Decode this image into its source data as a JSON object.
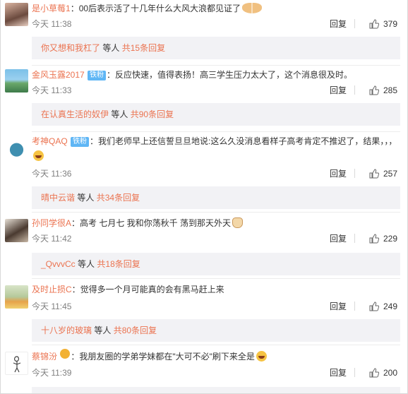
{
  "comments": [
    {
      "user": "是小草莓1",
      "badge": "",
      "text": "：00后表示活了十几年什么大风大浪都见证了",
      "emoji": "paws",
      "time": "今天 11:38",
      "reply_label": "回复",
      "likes": "379",
      "sub": {
        "who": "你又想和我杠了",
        "mid": "等人",
        "cnt": "共15条回复"
      }
    },
    {
      "user": "金风玉露2017",
      "badge": "铁粉",
      "text": "：反应快速，值得表扬！高三学生压力太大了，这个消息很及时。",
      "emoji": "",
      "time": "今天 11:33",
      "reply_label": "回复",
      "likes": "285",
      "sub": {
        "who": "在认真生活的奴伊",
        "mid": "等人",
        "cnt": "共90条回复"
      }
    },
    {
      "user": "考神QAQ",
      "badge": "铁粉",
      "text": "：我们老师早上还信誓旦旦地说:这么久没消息看样子高考肯定不推迟了，结果，，，",
      "emoji": "laugh",
      "time": "今天 11:36",
      "reply_label": "回复",
      "likes": "257",
      "sub": {
        "who": "晴中云谐",
        "mid": "等人",
        "cnt": "共34条回复"
      }
    },
    {
      "user": "孙同学很A",
      "badge": "",
      "text": "：高考 七月七 我和你荡秋千 荡到那天外天",
      "emoji": "cat",
      "time": "今天 11:42",
      "reply_label": "回复",
      "likes": "229",
      "sub": {
        "who": "_QvvvCc",
        "mid": "等人",
        "cnt": "共18条回复"
      }
    },
    {
      "user": "及时止损C",
      "badge": "",
      "text": "：觉得多一个月可能真的会有黑马赶上来",
      "emoji": "",
      "time": "今天 11:45",
      "reply_label": "回复",
      "likes": "249",
      "sub": {
        "who": "十八岁的玻璃",
        "mid": "等人",
        "cnt": "共80条回复"
      }
    },
    {
      "user": "蔡锦汾",
      "badge": "gold",
      "text": "：我朋友圈的学弟学妹都在\"大可不必\"刷下来全是",
      "emoji": "laugh",
      "time": "今天 11:39",
      "reply_label": "回复",
      "likes": "200",
      "sub": null
    }
  ],
  "colors": {
    "accent": "#eb7350",
    "badge": "#5fb6f5",
    "subbg": "#f2f2f5"
  }
}
